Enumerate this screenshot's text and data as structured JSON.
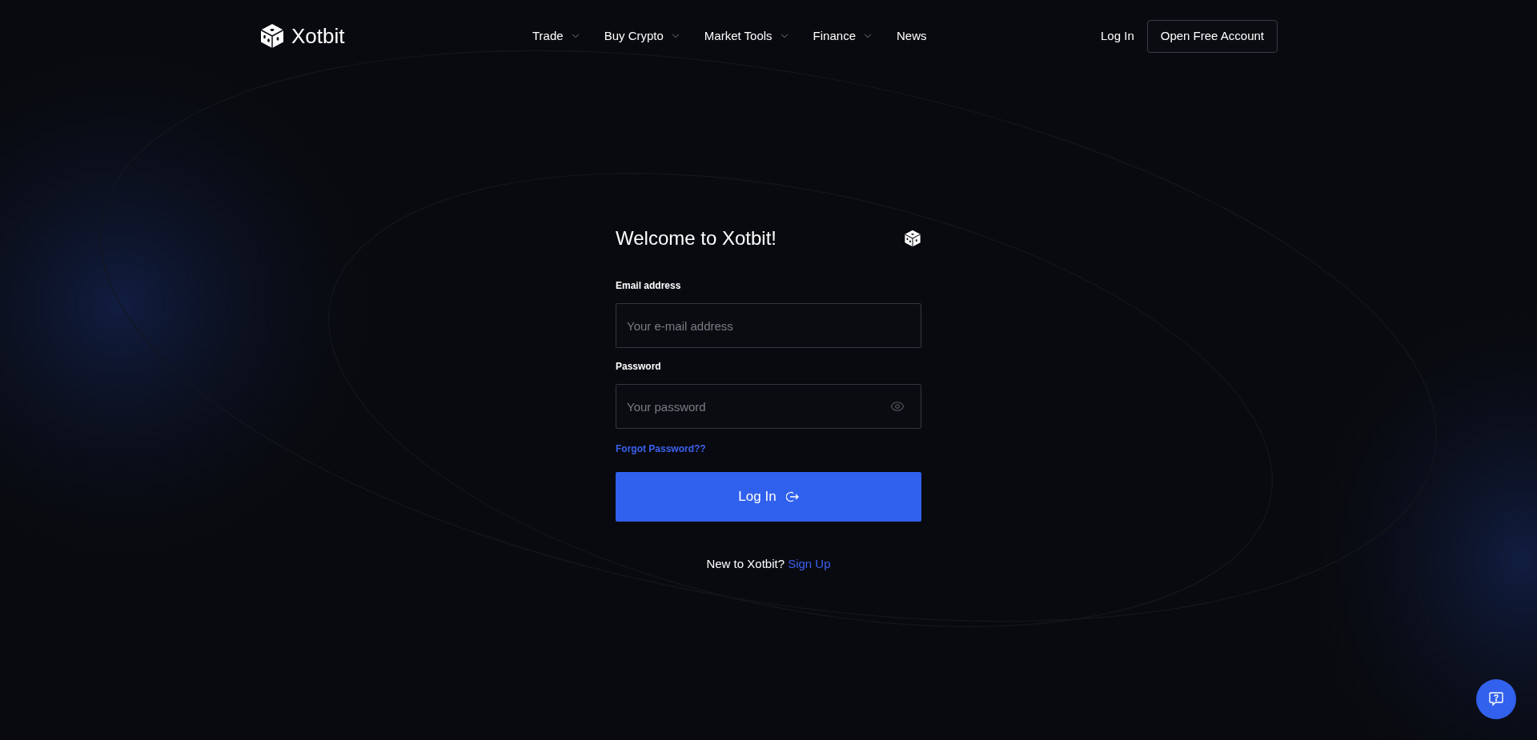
{
  "header": {
    "brand": "Xotbit",
    "nav": [
      {
        "label": "Trade",
        "has_menu": true
      },
      {
        "label": "Buy Crypto",
        "has_menu": true
      },
      {
        "label": "Market Tools",
        "has_menu": true
      },
      {
        "label": "Finance",
        "has_menu": true
      },
      {
        "label": "News",
        "has_menu": false
      }
    ],
    "login": "Log In",
    "signup": "Open Free Account"
  },
  "form": {
    "title": "Welcome to Xotbit!",
    "fields": [
      {
        "label": "Email address",
        "placeholder": "Your e-mail address",
        "kind": "email"
      },
      {
        "label": "Password",
        "placeholder": "Your password",
        "kind": "password"
      }
    ],
    "forgot": "Forgot Password??",
    "submit": "Log In",
    "signup_prompt": "New to Xotbit?",
    "signup_link": "Sign Up"
  }
}
